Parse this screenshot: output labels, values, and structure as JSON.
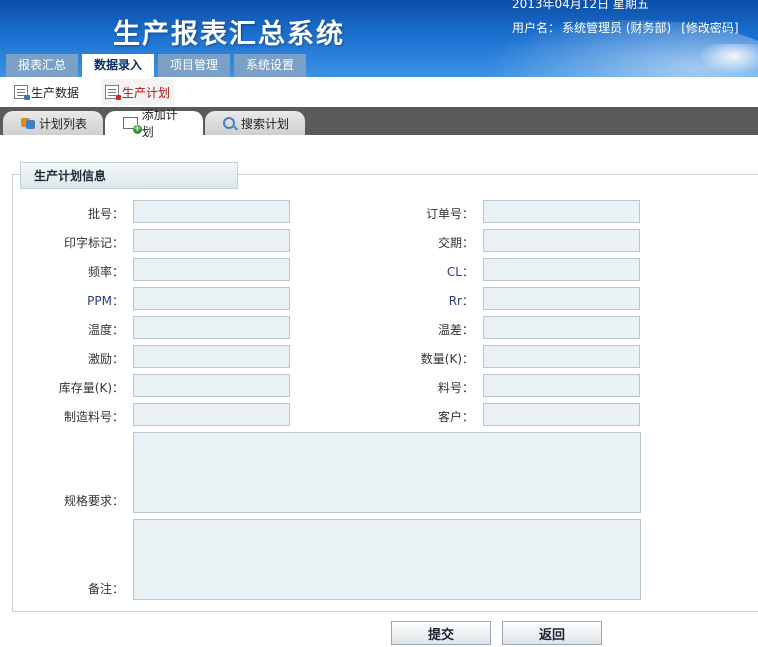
{
  "header": {
    "title": "生产报表汇总系统",
    "date": "2013年04月12日 星期五",
    "user_label": "用户名：",
    "user_value": "系统管理员 (财务部)",
    "change_password": "[修改密码]"
  },
  "main_nav": [
    {
      "label": "报表汇总",
      "active": false
    },
    {
      "label": "数据录入",
      "active": true
    },
    {
      "label": "项目管理",
      "active": false
    },
    {
      "label": "系统设置",
      "active": false
    }
  ],
  "sub_nav": [
    {
      "label": "生产数据",
      "icon": "doc-icon",
      "active": false
    },
    {
      "label": "生产计划",
      "icon": "doc-icon",
      "active": true
    }
  ],
  "tabs": [
    {
      "label": "计划列表",
      "icon": "list-icon",
      "active": false
    },
    {
      "label": "添加计划",
      "icon": "add-doc-icon",
      "active": true
    },
    {
      "label": "搜索计划",
      "icon": "search-icon",
      "active": false
    }
  ],
  "panel": {
    "title": "生产计划信息"
  },
  "fields": {
    "batch_no": {
      "label": "批号：",
      "value": ""
    },
    "order_no": {
      "label": "订单号：",
      "value": ""
    },
    "print_mark": {
      "label": "印字标记：",
      "value": ""
    },
    "delivery": {
      "label": "交期：",
      "value": ""
    },
    "frequency": {
      "label": "频率：",
      "value": ""
    },
    "cl": {
      "label": "CL：",
      "value": ""
    },
    "ppm": {
      "label": "PPM：",
      "value": ""
    },
    "rr": {
      "label": "Rr：",
      "value": ""
    },
    "temperature": {
      "label": "温度：",
      "value": ""
    },
    "temp_diff": {
      "label": "温差：",
      "value": ""
    },
    "excitation": {
      "label": "激励：",
      "value": ""
    },
    "quantity": {
      "label": "数量(K)：",
      "value": ""
    },
    "stock": {
      "label": "库存量(K)：",
      "value": ""
    },
    "material_no": {
      "label": "料号：",
      "value": ""
    },
    "mfg_material_no": {
      "label": "制造料号：",
      "value": ""
    },
    "customer": {
      "label": "客户：",
      "value": ""
    },
    "spec": {
      "label": "规格要求：",
      "value": ""
    },
    "remark": {
      "label": "备注：",
      "value": ""
    }
  },
  "buttons": {
    "submit": "提交",
    "back": "返回"
  }
}
